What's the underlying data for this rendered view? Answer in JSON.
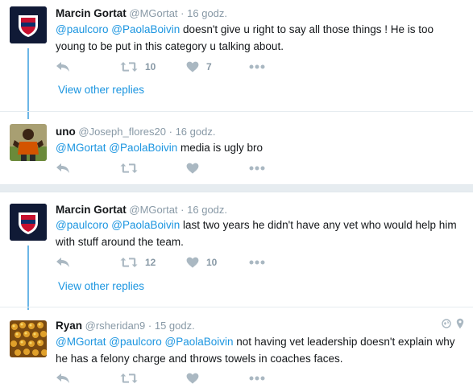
{
  "tweets": [
    {
      "name": "Marcin Gortat",
      "handle": "@MGortat",
      "sep": "·",
      "time": "16 godz.",
      "mentions": [
        "@paulcoro",
        "@PaolaBoivin"
      ],
      "text": "doesn't give u right to say all those things ! He is too young to be put in this category u talking about.",
      "retweets": "10",
      "likes": "7",
      "view_other_replies": "View other replies"
    },
    {
      "name": "uno",
      "handle": "@Joseph_flores20",
      "sep": "·",
      "time": "16 godz.",
      "mentions": [
        "@MGortat",
        "@PaolaBoivin"
      ],
      "text": "media is ugly bro",
      "retweets": "",
      "likes": ""
    },
    {
      "name": "Marcin Gortat",
      "handle": "@MGortat",
      "sep": "·",
      "time": "16 godz.",
      "mentions": [
        "@paulcoro",
        "@PaolaBoivin"
      ],
      "text": "last two years he didn't have any vet who would help him with stuff around the team.",
      "retweets": "12",
      "likes": "10",
      "view_other_replies": "View other replies"
    },
    {
      "name": "Ryan",
      "handle": "@rsheridan9",
      "sep": "·",
      "time": "15 godz.",
      "mentions": [
        "@MGortat",
        "@paulcoro",
        "@PaolaBoivin"
      ],
      "text": "not having vet leadership doesn't explain why he has a felony charge and throws towels in coaches faces.",
      "retweets": "",
      "likes": ""
    }
  ],
  "colors": {
    "link": "#1b95e0",
    "muted": "#8899a6",
    "thread": "#6cb6e6",
    "icon": "#aab8c2"
  },
  "icons": [
    "reply-icon",
    "retweet-icon",
    "like-icon",
    "more-icon",
    "globe-icon",
    "location-pin-icon"
  ]
}
